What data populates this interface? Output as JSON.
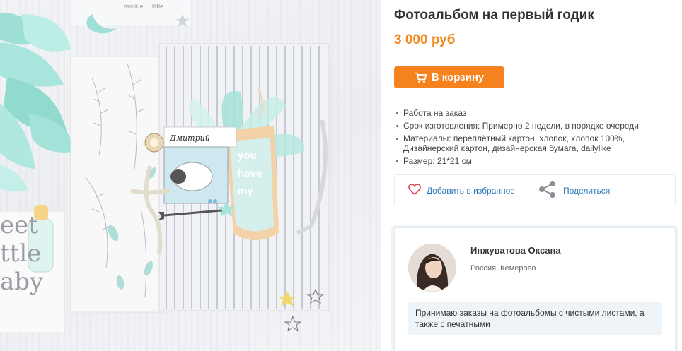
{
  "product": {
    "title": "Фотоальбом на первый годик",
    "price": "3 000 руб",
    "cart_button_label": "В корзину",
    "cart_icon": "shopping-cart-icon"
  },
  "specs": [
    "Работа на заказ",
    "Срок изготовления: Примерно 2 недели, в порядке очереди",
    "Материалы:  переплётный картон, хлопок, хлопок 100%, Дизайнерский картон, дизайнерская бумага, dailylike",
    "Размер: 21*21 см"
  ],
  "actions": {
    "favorite_label": "Добавить в избранное",
    "favorite_icon": "heart-icon",
    "share_label": "Поделиться",
    "share_icon": "share-icon"
  },
  "seller": {
    "name": "Инжуватова Оксана",
    "location": "Россия, Кемерово",
    "note": "Принимаю заказы на фотоальбомы с чистыми листами, а также с печатными"
  },
  "photo_text": {
    "tag_name": "Дмитрий",
    "tag_phrase_line1": "you",
    "tag_phrase_line2": "have",
    "tag_phrase_line3": "my",
    "corner_text_1": "twinkle",
    "corner_text_2": "little",
    "side_text_1": "eet",
    "side_text_2": "ttle",
    "side_text_3": "aby"
  },
  "colors": {
    "price": "#f28b1f",
    "button": "#f5821f",
    "link": "#2d7ab8",
    "mint": "#8fd9cf"
  }
}
